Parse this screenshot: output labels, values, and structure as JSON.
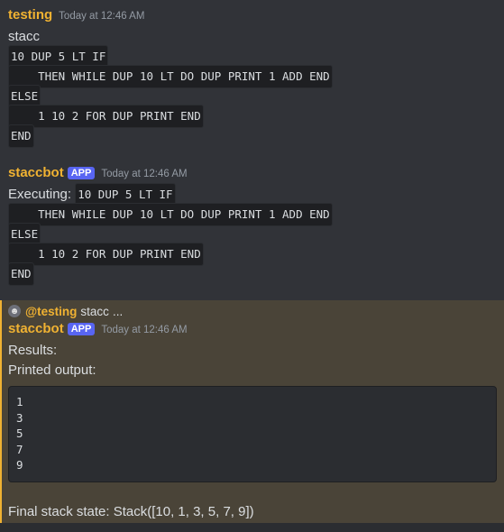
{
  "message1": {
    "author": "testing",
    "timestamp": "Today at 12:46 AM",
    "text": "stacc",
    "code_lines": [
      "10 DUP 5 LT IF",
      "    THEN WHILE DUP 10 LT DO DUP PRINT 1 ADD END",
      "ELSE",
      "    1 10 2 FOR DUP PRINT END",
      "END"
    ]
  },
  "message2": {
    "author": "staccbot",
    "badge": "APP",
    "timestamp": "Today at 12:46 AM",
    "prefix": "Executing: ",
    "code_lines": [
      "10 DUP 5 LT IF",
      "    THEN WHILE DUP 10 LT DO DUP PRINT 1 ADD END",
      "ELSE",
      "    1 10 2 FOR DUP PRINT END",
      "END"
    ]
  },
  "message3": {
    "reply": {
      "mention": "@testing",
      "content": "stacc",
      "ellipsis": "..."
    },
    "author": "staccbot",
    "badge": "APP",
    "timestamp": "Today at 12:46 AM",
    "results_label": "Results:",
    "printed_label": "Printed output:",
    "output_lines": [
      "1",
      "3",
      "5",
      "7",
      "9"
    ],
    "final_state": "Final stack state: Stack([10, 1, 3, 5, 7, 9])"
  },
  "colors": {
    "background": "#313338",
    "mention_highlight": "#4a4438",
    "author_name": "#f0b232",
    "app_badge": "#5865f2",
    "timestamp": "#949ba4"
  }
}
